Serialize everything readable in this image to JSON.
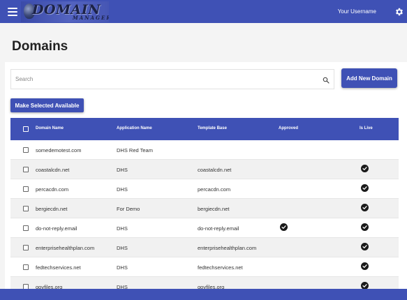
{
  "header": {
    "logo_text": "DOMAIN",
    "logo_sub": "MANAGER",
    "username": "Your Username",
    "accent": "#3f51b5"
  },
  "page": {
    "title": "Domains"
  },
  "search": {
    "placeholder": "Search",
    "value": ""
  },
  "buttons": {
    "add_new": "Add New Domain",
    "make_available": "Make Selected Available"
  },
  "table": {
    "headers": {
      "domain": "Domain Name",
      "application": "Application Name",
      "template": "Template Base",
      "approved": "Approved",
      "live": "Is Live"
    },
    "rows": [
      {
        "domain": "somedemotest.com",
        "application": "DHS Red Team",
        "template": "",
        "approved": false,
        "live": false
      },
      {
        "domain": "coastalcdn.net",
        "application": "DHS",
        "template": "coastalcdn.net",
        "approved": false,
        "live": true
      },
      {
        "domain": "percacdn.com",
        "application": "DHS",
        "template": "percacdn.com",
        "approved": false,
        "live": true
      },
      {
        "domain": "bergiecdn.net",
        "application": "For Demo",
        "template": "bergiecdn.net",
        "approved": false,
        "live": true
      },
      {
        "domain": "do-not-reply.email",
        "application": "DHS",
        "template": "do-not-reply.email",
        "approved": true,
        "live": true
      },
      {
        "domain": "enterprisehealthplan.com",
        "application": "DHS",
        "template": "enterprisehealthplan.com",
        "approved": false,
        "live": true
      },
      {
        "domain": "fedtechservices.net",
        "application": "DHS",
        "template": "fedtechservices.net",
        "approved": false,
        "live": true
      },
      {
        "domain": "govfiles.org",
        "application": "DHS",
        "template": "govfiles.org",
        "approved": false,
        "live": true
      }
    ]
  },
  "icons": {
    "menu": "menu-icon",
    "settings": "gear-icon",
    "search": "search-icon",
    "check": "check-circle-icon"
  }
}
